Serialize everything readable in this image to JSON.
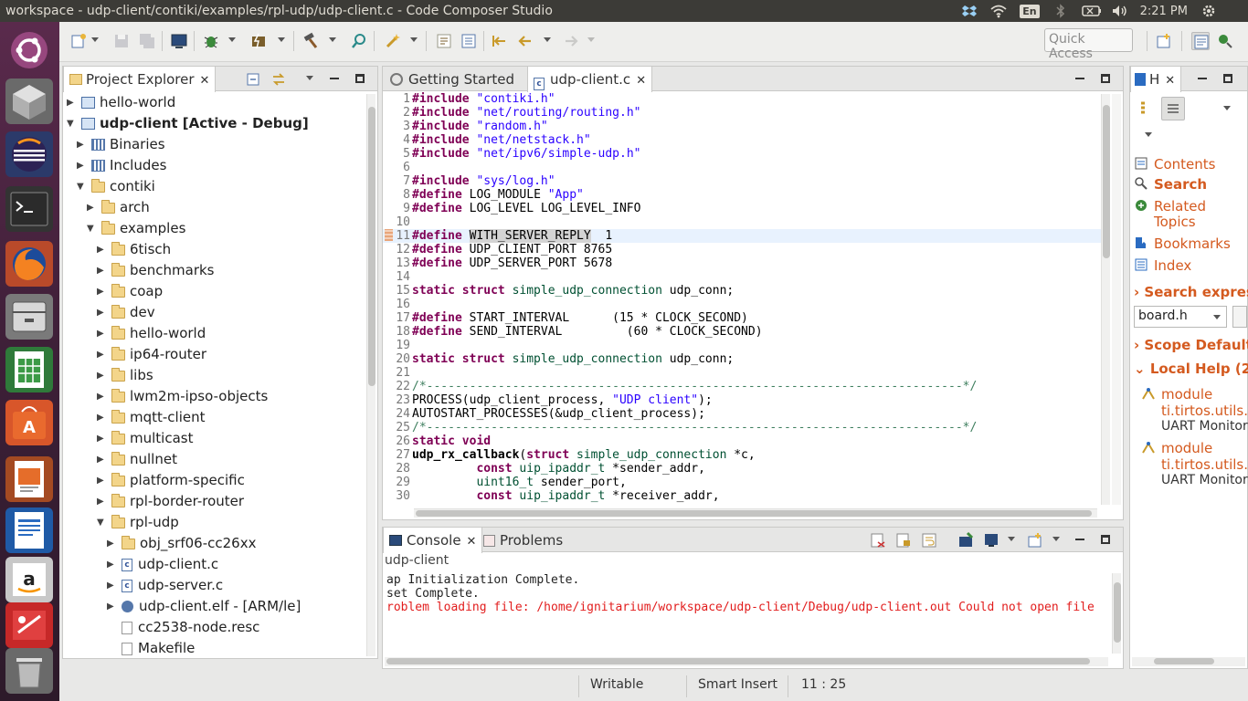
{
  "window": {
    "title": "workspace - udp-client/contiki/examples/rpl-udp/udp-client.c - Code Composer Studio"
  },
  "tray": {
    "language": "En",
    "time": "2:21 PM"
  },
  "toolbar": {
    "quick_access_placeholder": "Quick Access"
  },
  "project_explorer": {
    "title": "Project Explorer",
    "items": [
      {
        "label": "hello-world",
        "depth": 0,
        "expander": "closed",
        "icon": "project-icon"
      },
      {
        "label": "udp-client  [Active - Debug]",
        "depth": 0,
        "expander": "open",
        "icon": "project-icon",
        "bold": true
      },
      {
        "label": "Binaries",
        "depth": 1,
        "expander": "closed",
        "icon": "binaries-icon"
      },
      {
        "label": "Includes",
        "depth": 1,
        "expander": "closed",
        "icon": "includes-icon"
      },
      {
        "label": "contiki",
        "depth": 1,
        "expander": "open",
        "icon": "folder-icon"
      },
      {
        "label": "arch",
        "depth": 2,
        "expander": "closed",
        "icon": "folder-icon"
      },
      {
        "label": "examples",
        "depth": 2,
        "expander": "open",
        "icon": "folder-icon"
      },
      {
        "label": "6tisch",
        "depth": 3,
        "expander": "closed",
        "icon": "folder-icon"
      },
      {
        "label": "benchmarks",
        "depth": 3,
        "expander": "closed",
        "icon": "folder-icon"
      },
      {
        "label": "coap",
        "depth": 3,
        "expander": "closed",
        "icon": "folder-icon"
      },
      {
        "label": "dev",
        "depth": 3,
        "expander": "closed",
        "icon": "folder-icon"
      },
      {
        "label": "hello-world",
        "depth": 3,
        "expander": "closed",
        "icon": "folder-icon"
      },
      {
        "label": "ip64-router",
        "depth": 3,
        "expander": "closed",
        "icon": "folder-icon"
      },
      {
        "label": "libs",
        "depth": 3,
        "expander": "closed",
        "icon": "folder-icon"
      },
      {
        "label": "lwm2m-ipso-objects",
        "depth": 3,
        "expander": "closed",
        "icon": "folder-icon"
      },
      {
        "label": "mqtt-client",
        "depth": 3,
        "expander": "closed",
        "icon": "folder-icon"
      },
      {
        "label": "multicast",
        "depth": 3,
        "expander": "closed",
        "icon": "folder-icon"
      },
      {
        "label": "nullnet",
        "depth": 3,
        "expander": "closed",
        "icon": "folder-icon"
      },
      {
        "label": "platform-specific",
        "depth": 3,
        "expander": "closed",
        "icon": "folder-icon"
      },
      {
        "label": "rpl-border-router",
        "depth": 3,
        "expander": "closed",
        "icon": "folder-icon"
      },
      {
        "label": "rpl-udp",
        "depth": 3,
        "expander": "open",
        "icon": "folder-icon"
      },
      {
        "label": "obj_srf06-cc26xx",
        "depth": 4,
        "expander": "closed",
        "icon": "folder-icon"
      },
      {
        "label": "udp-client.c",
        "depth": 4,
        "expander": "closed",
        "icon": "c-file-icon"
      },
      {
        "label": "udp-server.c",
        "depth": 4,
        "expander": "closed",
        "icon": "c-file-icon"
      },
      {
        "label": "udp-client.elf - [ARM/le]",
        "depth": 4,
        "expander": "closed",
        "icon": "elf-icon"
      },
      {
        "label": "cc2538-node.resc",
        "depth": 4,
        "expander": "none",
        "icon": "file-icon"
      },
      {
        "label": "Makefile",
        "depth": 4,
        "expander": "none",
        "icon": "file-icon"
      }
    ]
  },
  "editor": {
    "tabs": [
      {
        "label": "Getting Started",
        "active": false
      },
      {
        "label": "udp-client.c",
        "active": true
      }
    ],
    "current_line": 11,
    "lines": [
      {
        "n": "1",
        "segs": [
          {
            "t": "#include ",
            "c": "kw"
          },
          {
            "t": "\"contiki.h\"",
            "c": "str"
          }
        ]
      },
      {
        "n": "2",
        "segs": [
          {
            "t": "#include ",
            "c": "kw"
          },
          {
            "t": "\"net/routing/routing.h\"",
            "c": "str"
          }
        ]
      },
      {
        "n": "3",
        "segs": [
          {
            "t": "#include ",
            "c": "kw"
          },
          {
            "t": "\"random.h\"",
            "c": "str"
          }
        ]
      },
      {
        "n": "4",
        "segs": [
          {
            "t": "#include ",
            "c": "kw"
          },
          {
            "t": "\"net/netstack.h\"",
            "c": "str"
          }
        ]
      },
      {
        "n": "5",
        "segs": [
          {
            "t": "#include ",
            "c": "kw"
          },
          {
            "t": "\"net/ipv6/simple-udp.h\"",
            "c": "str"
          }
        ]
      },
      {
        "n": "6",
        "segs": []
      },
      {
        "n": "7",
        "segs": [
          {
            "t": "#include ",
            "c": "kw"
          },
          {
            "t": "\"sys/log.h\"",
            "c": "str"
          }
        ]
      },
      {
        "n": "8",
        "segs": [
          {
            "t": "#define ",
            "c": "kw"
          },
          {
            "t": "LOG_MODULE ",
            "c": ""
          },
          {
            "t": "\"App\"",
            "c": "str"
          }
        ]
      },
      {
        "n": "9",
        "segs": [
          {
            "t": "#define ",
            "c": "kw"
          },
          {
            "t": "LOG_LEVEL LOG_LEVEL_INFO",
            "c": ""
          }
        ]
      },
      {
        "n": "10",
        "segs": []
      },
      {
        "n": "11",
        "segs": [
          {
            "t": "#define ",
            "c": "kw"
          },
          {
            "t": "WITH_SERVER_REPLY",
            "c": "hl"
          },
          {
            "t": "  1",
            "c": ""
          }
        ]
      },
      {
        "n": "12",
        "segs": [
          {
            "t": "#define ",
            "c": "kw"
          },
          {
            "t": "UDP_CLIENT_PORT 8765",
            "c": ""
          }
        ]
      },
      {
        "n": "13",
        "segs": [
          {
            "t": "#define ",
            "c": "kw"
          },
          {
            "t": "UDP_SERVER_PORT 5678",
            "c": ""
          }
        ]
      },
      {
        "n": "14",
        "segs": []
      },
      {
        "n": "15",
        "segs": [
          {
            "t": "static struct ",
            "c": "kw"
          },
          {
            "t": "simple_udp_connection",
            "c": "typ"
          },
          {
            "t": " udp_conn;",
            "c": ""
          }
        ]
      },
      {
        "n": "16",
        "segs": []
      },
      {
        "n": "17",
        "segs": [
          {
            "t": "#define ",
            "c": "kw"
          },
          {
            "t": "START_INTERVAL      (15 * CLOCK_SECOND)",
            "c": ""
          }
        ]
      },
      {
        "n": "18",
        "segs": [
          {
            "t": "#define ",
            "c": "kw"
          },
          {
            "t": "SEND_INTERVAL         (60 * CLOCK_SECOND)",
            "c": ""
          }
        ]
      },
      {
        "n": "19",
        "segs": []
      },
      {
        "n": "20",
        "segs": [
          {
            "t": "static struct ",
            "c": "kw"
          },
          {
            "t": "simple_udp_connection",
            "c": "typ"
          },
          {
            "t": " udp_conn;",
            "c": ""
          }
        ]
      },
      {
        "n": "21",
        "segs": []
      },
      {
        "n": "22",
        "segs": [
          {
            "t": "/*---------------------------------------------------------------------------*/",
            "c": "cmt"
          }
        ]
      },
      {
        "n": "23",
        "segs": [
          {
            "t": "PROCESS(udp_client_process, ",
            "c": ""
          },
          {
            "t": "\"UDP client\"",
            "c": "str"
          },
          {
            "t": ");",
            "c": ""
          }
        ]
      },
      {
        "n": "24",
        "segs": [
          {
            "t": "AUTOSTART_PROCESSES(&udp_client_process);",
            "c": ""
          }
        ]
      },
      {
        "n": "25",
        "segs": [
          {
            "t": "/*---------------------------------------------------------------------------*/",
            "c": "cmt"
          }
        ]
      },
      {
        "n": "26",
        "segs": [
          {
            "t": "static void",
            "c": "kw"
          }
        ]
      },
      {
        "n": "27",
        "segs": [
          {
            "t": "udp_rx_callback",
            "c": "bold"
          },
          {
            "t": "(",
            "c": ""
          },
          {
            "t": "struct ",
            "c": "kw"
          },
          {
            "t": "simple_udp_connection",
            "c": "typ"
          },
          {
            "t": " *c,",
            "c": ""
          }
        ]
      },
      {
        "n": "28",
        "segs": [
          {
            "t": "         ",
            "c": ""
          },
          {
            "t": "const ",
            "c": "kw"
          },
          {
            "t": "uip_ipaddr_t",
            "c": "typ"
          },
          {
            "t": " *sender_addr,",
            "c": ""
          }
        ]
      },
      {
        "n": "29",
        "segs": [
          {
            "t": "         ",
            "c": ""
          },
          {
            "t": "uint16_t",
            "c": "typ"
          },
          {
            "t": " sender_port,",
            "c": ""
          }
        ]
      },
      {
        "n": "30",
        "segs": [
          {
            "t": "         ",
            "c": ""
          },
          {
            "t": "const ",
            "c": "kw"
          },
          {
            "t": "uip_ipaddr_t",
            "c": "typ"
          },
          {
            "t": " *receiver_addr,",
            "c": ""
          }
        ]
      }
    ]
  },
  "console": {
    "tabs": [
      {
        "label": "Console",
        "active": true
      },
      {
        "label": "Problems",
        "active": false
      }
    ],
    "subtitle": "udp-client",
    "lines": [
      {
        "text": "ap Initialization Complete.",
        "error": false
      },
      {
        "text": "set Complete.",
        "error": false
      },
      {
        "text": "roblem loading file: /home/ignitarium/workspace/udp-client/Debug/udp-client.out Could not open file",
        "error": true
      }
    ]
  },
  "help": {
    "tab_label": "H",
    "links": {
      "contents": "Contents",
      "search": "Search",
      "related_topics_1": "Related",
      "related_topics_2": "Topics",
      "bookmarks": "Bookmarks",
      "index": "Index"
    },
    "search_expression_label": "Search express",
    "search_value": "board.h",
    "scope_label": "Scope Default",
    "local_help_label": "Local Help (2",
    "results": [
      {
        "line1": "module",
        "line2": "ti.tirtos.utils.",
        "line3": "UART Monitor"
      },
      {
        "line1": "module",
        "line2": "ti.tirtos.utils.",
        "line3": "UART Monitor"
      }
    ]
  },
  "status": {
    "writable": "Writable",
    "insert_mode": "Smart Insert",
    "position": "11 : 25"
  },
  "colors": {
    "keyword": "#7f0055",
    "string": "#2a00ff",
    "type": "#005032",
    "comment": "#3f7f5f",
    "error": "#e21d1d",
    "help_link": "#d45a1f"
  }
}
